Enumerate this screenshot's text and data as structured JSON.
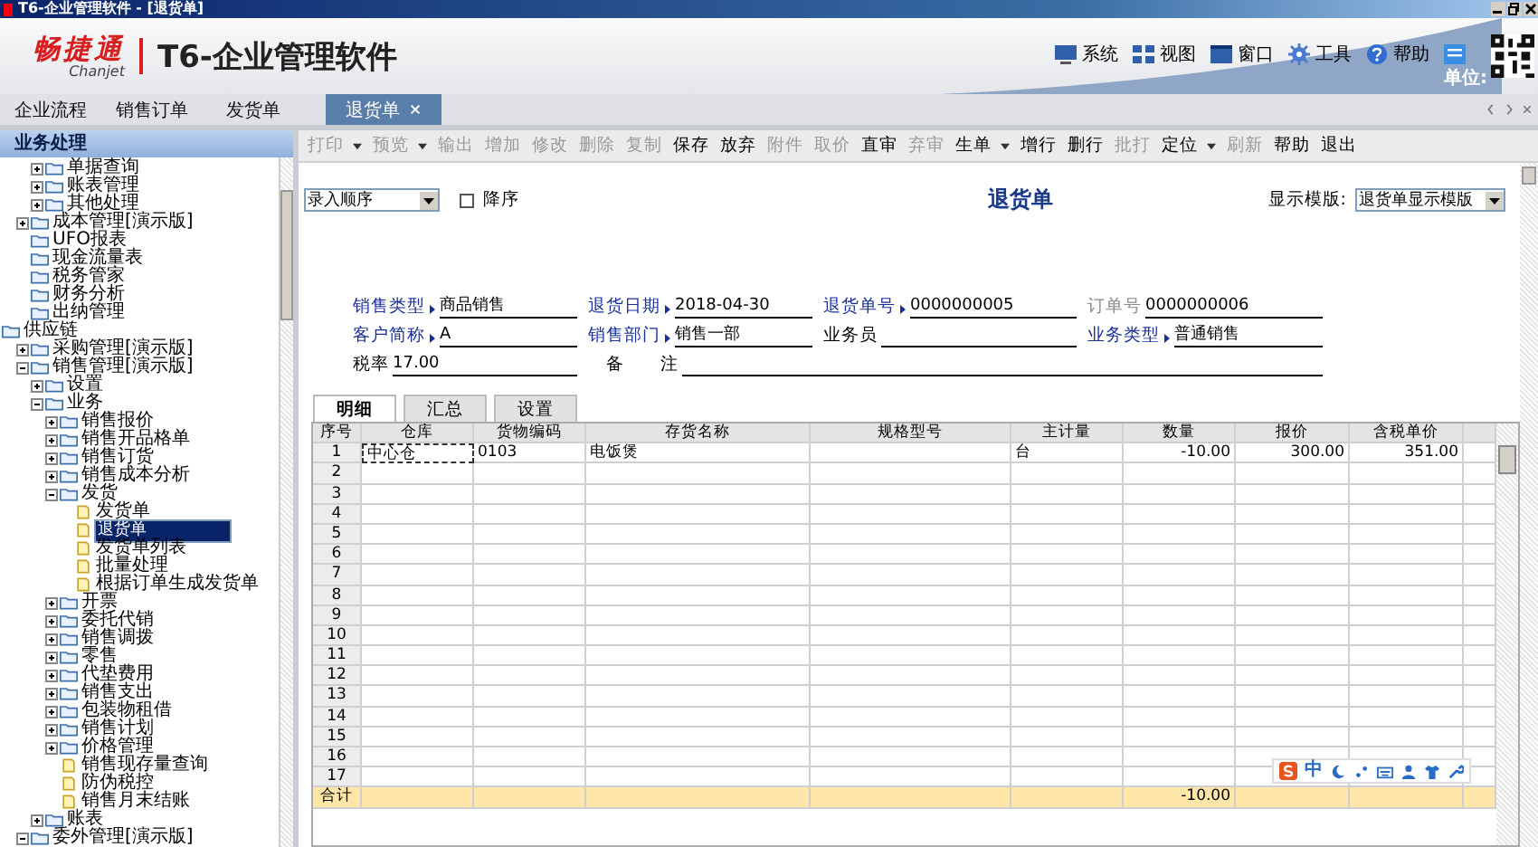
{
  "window": {
    "title": "T6-企业管理软件 - [退货单]"
  },
  "brand": {
    "name": "畅捷通",
    "sub": "Chanjet",
    "product": "T6-企业管理软件"
  },
  "menu": [
    {
      "label": "系统"
    },
    {
      "label": "视图"
    },
    {
      "label": "窗口"
    },
    {
      "label": "工具"
    },
    {
      "label": "帮助"
    }
  ],
  "unit_label": "单位:",
  "tabs": [
    {
      "label": "企业流程",
      "selected": false
    },
    {
      "label": "销售订单",
      "selected": false
    },
    {
      "label": "发货单",
      "selected": false
    },
    {
      "label": "退货单",
      "selected": true
    }
  ],
  "sidebar": {
    "title": "业务处理",
    "tree": [
      {
        "children": [
          {
            "children": [
              {
                "label": "单据查询",
                "kind": "folder",
                "expanded": false,
                "selected": false
              },
              {
                "label": "账表管理",
                "kind": "folder",
                "expanded": false,
                "selected": false
              },
              {
                "label": "其他处理",
                "kind": "folder",
                "expanded": false,
                "selected": false
              }
            ]
          },
          {
            "label": "成本管理[演示版]",
            "kind": "folder",
            "expanded": false,
            "selected": false
          },
          {
            "label": "UFO报表",
            "kind": "folder",
            "selected": false
          },
          {
            "label": "现金流量表",
            "kind": "folder",
            "selected": false
          },
          {
            "label": "税务管家",
            "kind": "folder",
            "selected": false
          },
          {
            "label": "财务分析",
            "kind": "folder",
            "selected": false
          },
          {
            "label": "出纳管理",
            "kind": "folder",
            "selected": false
          }
        ]
      },
      {
        "label": "供应链",
        "kind": "folder",
        "selected": false,
        "children": [
          {
            "label": "采购管理[演示版]",
            "kind": "folder",
            "expanded": false,
            "selected": false
          },
          {
            "label": "销售管理[演示版]",
            "kind": "folder",
            "expanded": true,
            "selected": false,
            "children": [
              {
                "label": "设置",
                "kind": "folder",
                "expanded": false,
                "selected": false
              },
              {
                "label": "业务",
                "kind": "folder",
                "expanded": true,
                "selected": false,
                "children": [
                  {
                    "label": "销售报价",
                    "kind": "folder",
                    "expanded": false,
                    "selected": false
                  },
                  {
                    "label": "销售开品格单",
                    "kind": "folder",
                    "expanded": false,
                    "selected": false
                  },
                  {
                    "label": "销售订货",
                    "kind": "folder",
                    "expanded": false,
                    "selected": false
                  },
                  {
                    "label": "销售成本分析",
                    "kind": "folder",
                    "expanded": false,
                    "selected": false
                  },
                  {
                    "label": "发货",
                    "kind": "folder",
                    "expanded": true,
                    "selected": false,
                    "children": [
                      {
                        "label": "发货单",
                        "kind": "doc",
                        "selected": false
                      },
                      {
                        "label": "退货单",
                        "kind": "doc",
                        "selected": true
                      },
                      {
                        "label": "发货单列表",
                        "kind": "doc",
                        "selected": false
                      },
                      {
                        "label": "批量处理",
                        "kind": "doc",
                        "selected": false
                      },
                      {
                        "label": "根据订单生成发货单",
                        "kind": "doc",
                        "selected": false
                      }
                    ]
                  },
                  {
                    "label": "开票",
                    "kind": "folder",
                    "expanded": false,
                    "selected": false
                  },
                  {
                    "label": "委托代销",
                    "kind": "folder",
                    "expanded": false,
                    "selected": false
                  },
                  {
                    "label": "销售调拨",
                    "kind": "folder",
                    "expanded": false,
                    "selected": false
                  },
                  {
                    "label": "零售",
                    "kind": "folder",
                    "expanded": false,
                    "selected": false
                  },
                  {
                    "label": "代垫费用",
                    "kind": "folder",
                    "expanded": false,
                    "selected": false
                  },
                  {
                    "label": "销售支出",
                    "kind": "folder",
                    "expanded": false,
                    "selected": false
                  },
                  {
                    "label": "包装物租借",
                    "kind": "folder",
                    "expanded": false,
                    "selected": false
                  },
                  {
                    "label": "销售计划",
                    "kind": "folder",
                    "expanded": false,
                    "selected": false
                  },
                  {
                    "label": "价格管理",
                    "kind": "folder",
                    "expanded": false,
                    "selected": false
                  },
                  {
                    "label": "销售现存量查询",
                    "kind": "doc",
                    "selected": false
                  },
                  {
                    "label": "防伪税控",
                    "kind": "doc",
                    "selected": false
                  },
                  {
                    "label": "销售月末结账",
                    "kind": "doc",
                    "selected": false
                  }
                ]
              },
              {
                "label": "账表",
                "kind": "folder",
                "expanded": false,
                "selected": false
              }
            ]
          },
          {
            "label": "委外管理[演示版]",
            "kind": "folder",
            "expanded": true,
            "selected": false
          }
        ]
      }
    ]
  },
  "toolbar": [
    {
      "label": "打印",
      "disabled": true,
      "dropdown": true
    },
    {
      "label": "预览",
      "disabled": true,
      "dropdown": true
    },
    {
      "label": "输出",
      "disabled": true,
      "dropdown": false
    },
    {
      "label": "增加",
      "disabled": true,
      "dropdown": false
    },
    {
      "label": "修改",
      "disabled": true,
      "dropdown": false
    },
    {
      "label": "删除",
      "disabled": true,
      "dropdown": false
    },
    {
      "label": "复制",
      "disabled": true,
      "dropdown": false
    },
    {
      "label": "保存",
      "disabled": false,
      "dropdown": false
    },
    {
      "label": "放弃",
      "disabled": false,
      "dropdown": false
    },
    {
      "label": "附件",
      "disabled": true,
      "dropdown": false
    },
    {
      "label": "取价",
      "disabled": true,
      "dropdown": false
    },
    {
      "label": "直审",
      "disabled": false,
      "dropdown": false
    },
    {
      "label": "弃审",
      "disabled": true,
      "dropdown": false
    },
    {
      "label": "生单",
      "disabled": false,
      "dropdown": true
    },
    {
      "label": "增行",
      "disabled": false,
      "dropdown": false
    },
    {
      "label": "删行",
      "disabled": false,
      "dropdown": false
    },
    {
      "label": "批打",
      "disabled": true,
      "dropdown": false
    },
    {
      "label": "定位",
      "disabled": false,
      "dropdown": true
    },
    {
      "label": "刷新",
      "disabled": true,
      "dropdown": false
    },
    {
      "label": "帮助",
      "disabled": false,
      "dropdown": false
    },
    {
      "label": "退出",
      "disabled": false,
      "dropdown": false
    }
  ],
  "form": {
    "sort_select": "录入顺序",
    "descending": {
      "label": "降序",
      "checked": false
    },
    "title": "退货单",
    "template_label": "显示模版:",
    "template_select": "退货单显示模版",
    "fields": [
      {
        "label": "销售类型",
        "value": "商品销售",
        "required": true,
        "disabled": false,
        "kind": "normal"
      },
      {
        "label": "退货日期",
        "value": "2018-04-30",
        "required": true,
        "disabled": false,
        "kind": "normal"
      },
      {
        "label": "退货单号",
        "value": "0000000005",
        "required": true,
        "disabled": false,
        "kind": "normal"
      },
      {
        "label": "订单号",
        "value": "0000000006",
        "required": false,
        "disabled": true,
        "kind": "normal"
      },
      {
        "label": "客户简称",
        "value": "A",
        "required": true,
        "disabled": false,
        "kind": "normal"
      },
      {
        "label": "销售部门",
        "value": "销售一部",
        "required": true,
        "disabled": false,
        "kind": "normal"
      },
      {
        "label": "业务员",
        "required": false,
        "disabled": false,
        "kind": "normal"
      },
      {
        "label": "业务类型",
        "value": "普通销售",
        "required": true,
        "disabled": false,
        "kind": "normal"
      },
      {
        "label": "税率",
        "value": "17.00",
        "required": false,
        "disabled": false,
        "kind": "normal"
      },
      {
        "label": "备　　注",
        "required": false,
        "disabled": false,
        "kind": "wide"
      }
    ]
  },
  "detail_tabs": [
    {
      "label": "明细",
      "selected": true
    },
    {
      "label": "汇总",
      "selected": false
    },
    {
      "label": "设置",
      "selected": false
    }
  ],
  "table": {
    "columns": [
      "序号",
      "仓库",
      "货物编码",
      "存货名称",
      "规格型号",
      "主计量",
      "数量",
      "报价",
      "含税单价"
    ],
    "rows": [
      {
        "no": "1",
        "cells": [
          "中心仓",
          "0103",
          "电饭煲",
          null,
          "台",
          "-10.00",
          "300.00",
          "351.00"
        ]
      },
      {
        "no": "2"
      },
      {
        "no": "3"
      },
      {
        "no": "4"
      },
      {
        "no": "5"
      },
      {
        "no": "6"
      },
      {
        "no": "7"
      },
      {
        "no": "8"
      },
      {
        "no": "9"
      },
      {
        "no": "10"
      },
      {
        "no": "11"
      },
      {
        "no": "12"
      },
      {
        "no": "13"
      },
      {
        "no": "14"
      },
      {
        "no": "15"
      },
      {
        "no": "16"
      },
      {
        "no": "17"
      }
    ],
    "total": {
      "no": "合计",
      "cells": [
        null,
        null,
        null,
        null,
        null,
        "-10.00"
      ]
    }
  },
  "ime_bar": {
    "label": "中"
  }
}
